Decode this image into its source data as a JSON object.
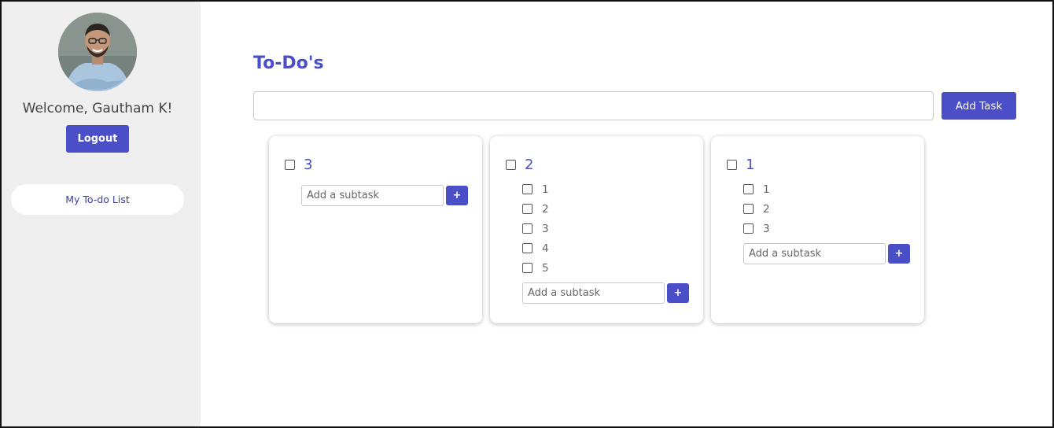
{
  "sidebar": {
    "welcome_text": "Welcome, Gautham K!",
    "logout_label": "Logout",
    "nav": [
      {
        "label": "My To-do List"
      }
    ]
  },
  "main": {
    "title": "To-Do's",
    "task_input": {
      "value": "",
      "placeholder": ""
    },
    "add_task_label": "Add Task",
    "subtask_placeholder": "Add a subtask",
    "plus_label": "+",
    "cards": [
      {
        "title": "3",
        "checked": false,
        "subtasks": []
      },
      {
        "title": "2",
        "checked": false,
        "subtasks": [
          {
            "label": "1",
            "checked": false
          },
          {
            "label": "2",
            "checked": false
          },
          {
            "label": "3",
            "checked": false
          },
          {
            "label": "4",
            "checked": false
          },
          {
            "label": "5",
            "checked": false
          }
        ]
      },
      {
        "title": "1",
        "checked": false,
        "subtasks": [
          {
            "label": "1",
            "checked": false
          },
          {
            "label": "2",
            "checked": false
          },
          {
            "label": "3",
            "checked": false
          }
        ]
      }
    ]
  },
  "colors": {
    "accent": "#4b4fc7",
    "sidebar_bg": "#efefef",
    "nav_text": "#3a3fa8"
  },
  "icons": {
    "avatar": "user-photo",
    "checkbox": "checkbox-icon"
  }
}
